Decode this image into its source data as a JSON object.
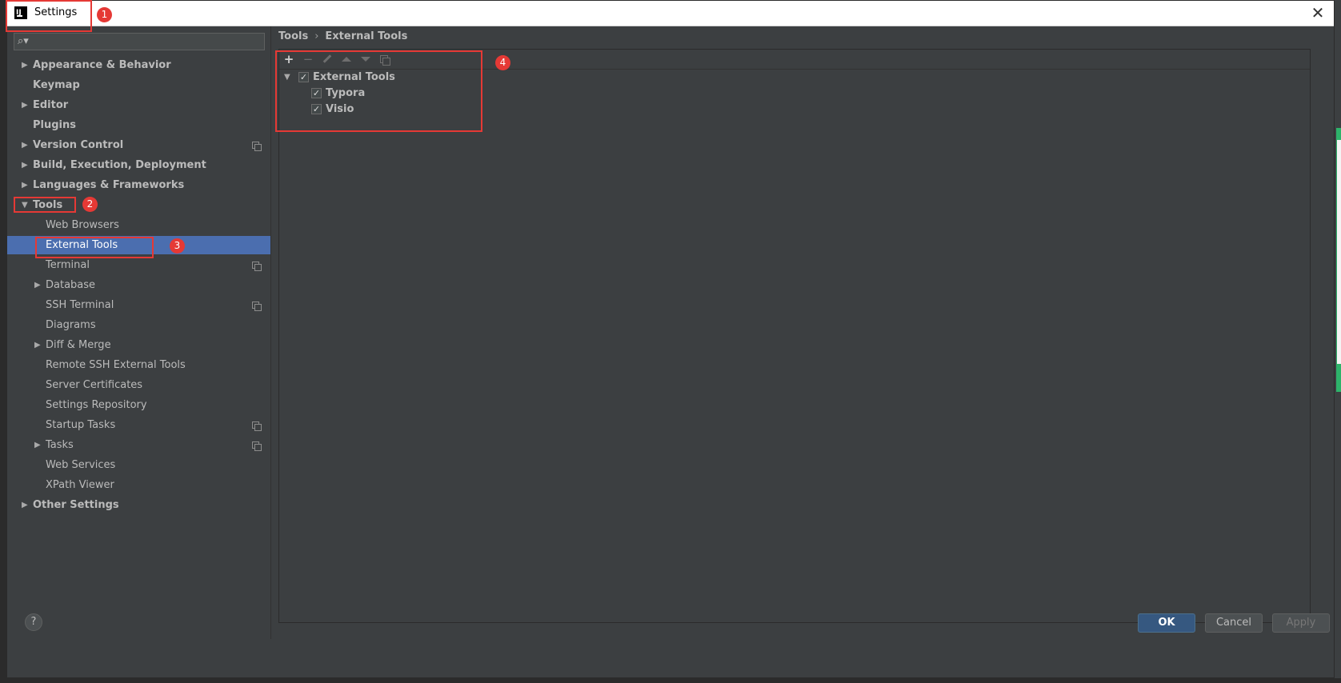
{
  "window": {
    "title": "Settings",
    "close_glyph": "✕",
    "app_icon_text": "IJ"
  },
  "search": {
    "placeholder": "",
    "icon_glyph": "🔍"
  },
  "sidebar": {
    "items": [
      {
        "label": "Appearance & Behavior",
        "level": 0,
        "expandable": true,
        "expanded": false,
        "bold": true,
        "project_icon": false
      },
      {
        "label": "Keymap",
        "level": 0,
        "expandable": false,
        "bold": true,
        "project_icon": false
      },
      {
        "label": "Editor",
        "level": 0,
        "expandable": true,
        "expanded": false,
        "bold": true,
        "project_icon": false
      },
      {
        "label": "Plugins",
        "level": 0,
        "expandable": false,
        "bold": true,
        "project_icon": false
      },
      {
        "label": "Version Control",
        "level": 0,
        "expandable": true,
        "expanded": false,
        "bold": true,
        "project_icon": true
      },
      {
        "label": "Build, Execution, Deployment",
        "level": 0,
        "expandable": true,
        "expanded": false,
        "bold": true,
        "project_icon": false
      },
      {
        "label": "Languages & Frameworks",
        "level": 0,
        "expandable": true,
        "expanded": false,
        "bold": true,
        "project_icon": false
      },
      {
        "label": "Tools",
        "level": 0,
        "expandable": true,
        "expanded": true,
        "bold": true,
        "project_icon": false
      },
      {
        "label": "Web Browsers",
        "level": 1,
        "expandable": false,
        "bold": false,
        "project_icon": false
      },
      {
        "label": "External Tools",
        "level": 1,
        "expandable": false,
        "bold": false,
        "selected": true,
        "project_icon": false
      },
      {
        "label": "Terminal",
        "level": 1,
        "expandable": false,
        "bold": false,
        "project_icon": true
      },
      {
        "label": "Database",
        "level": 1,
        "expandable": true,
        "expanded": false,
        "bold": false,
        "project_icon": false
      },
      {
        "label": "SSH Terminal",
        "level": 1,
        "expandable": false,
        "bold": false,
        "project_icon": true
      },
      {
        "label": "Diagrams",
        "level": 1,
        "expandable": false,
        "bold": false,
        "project_icon": false
      },
      {
        "label": "Diff & Merge",
        "level": 1,
        "expandable": true,
        "expanded": false,
        "bold": false,
        "project_icon": false
      },
      {
        "label": "Remote SSH External Tools",
        "level": 1,
        "expandable": false,
        "bold": false,
        "project_icon": false
      },
      {
        "label": "Server Certificates",
        "level": 1,
        "expandable": false,
        "bold": false,
        "project_icon": false
      },
      {
        "label": "Settings Repository",
        "level": 1,
        "expandable": false,
        "bold": false,
        "project_icon": false
      },
      {
        "label": "Startup Tasks",
        "level": 1,
        "expandable": false,
        "bold": false,
        "project_icon": true
      },
      {
        "label": "Tasks",
        "level": 1,
        "expandable": true,
        "expanded": false,
        "bold": false,
        "project_icon": true
      },
      {
        "label": "Web Services",
        "level": 1,
        "expandable": false,
        "bold": false,
        "project_icon": false
      },
      {
        "label": "XPath Viewer",
        "level": 1,
        "expandable": false,
        "bold": false,
        "project_icon": false
      },
      {
        "label": "Other Settings",
        "level": 0,
        "expandable": true,
        "expanded": false,
        "bold": true,
        "project_icon": false
      }
    ]
  },
  "breadcrumb": {
    "parent": "Tools",
    "separator": "›",
    "current": "External Tools"
  },
  "toolbar": {
    "add_glyph": "+",
    "remove_glyph": "−"
  },
  "tools_tree": {
    "group": {
      "label": "External Tools",
      "checked": true,
      "expanded": true
    },
    "children": [
      {
        "label": "Typora",
        "checked": true
      },
      {
        "label": "Visio",
        "checked": true
      }
    ],
    "check_glyph": "✓",
    "expanded_arrow": "▼"
  },
  "tree_arrows": {
    "collapsed": "▶",
    "expanded": "▼"
  },
  "annotations": [
    "1",
    "2",
    "3",
    "4"
  ],
  "footer": {
    "help_label": "?",
    "ok_label": "OK",
    "cancel_label": "Cancel",
    "apply_label": "Apply"
  },
  "colors": {
    "background": "#3c3f41",
    "selection": "#4b6eaf",
    "annotation": "#e53935",
    "primary_button": "#365880"
  }
}
